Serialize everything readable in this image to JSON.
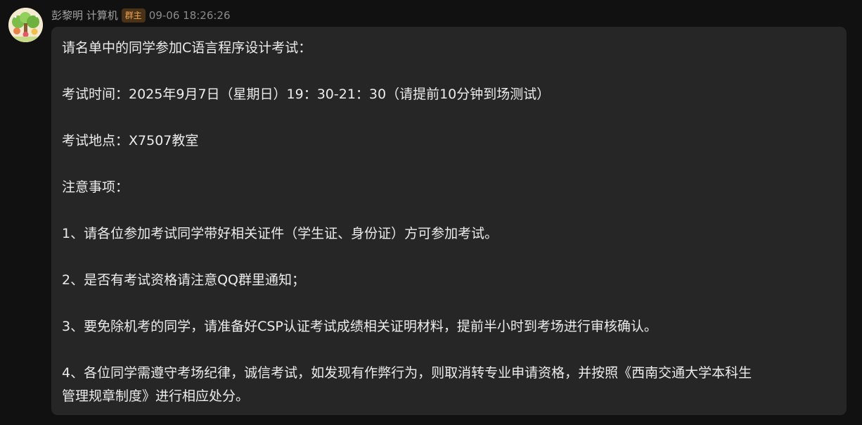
{
  "sender": {
    "name": "彭黎明 计算机",
    "role_badge": "群主",
    "timestamp": "09-06 18:26:26"
  },
  "message": {
    "lines": [
      "请名单中的同学参加C语言程序设计考试：",
      "",
      "考试时间：2025年9月7日（星期日）19：30-21：30（请提前10分钟到场测试）",
      "",
      "考试地点：X7507教室",
      "",
      "注意事项：",
      "",
      "1、请各位参加考试同学带好相关证件（学生证、身份证）方可参加考试。",
      "",
      "2、是否有考试资格请注意QQ群里通知；",
      "",
      "3、要免除机考的同学，请准备好CSP认证考试成绩相关证明材料，提前半小时到考场进行审核确认。",
      "",
      "4、各位同学需遵守考场纪律，诚信考试，如发现有作弊行为，则取消转专业申请资格，并按照《西南交通大学本科生",
      "管理规章制度》进行相应处分。"
    ]
  },
  "colors": {
    "background": "#111111",
    "bubble": "#262626",
    "badge_bg": "#4a3219",
    "badge_text": "#f0a650"
  }
}
